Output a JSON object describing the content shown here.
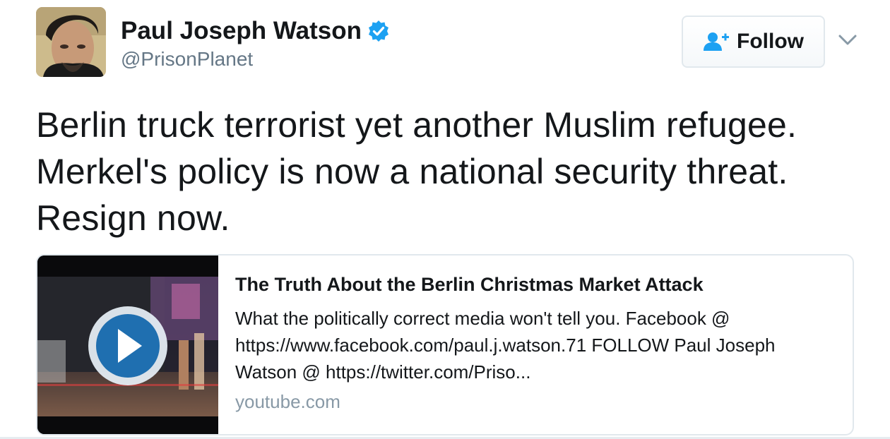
{
  "author": {
    "display_name": "Paul Joseph Watson",
    "handle": "@PrisonPlanet",
    "verified": true,
    "avatar_icon": "profile-photo"
  },
  "follow_button": {
    "label": "Follow",
    "icon": "user-add-icon"
  },
  "more_menu": {
    "icon": "chevron-down-icon"
  },
  "tweet": {
    "lines": [
      "Berlin truck terrorist yet another Muslim refugee.",
      "Merkel's policy is now a national security threat.",
      "Resign now."
    ]
  },
  "card": {
    "title": "The Truth About the Berlin Christmas Market Attack",
    "description": "What the politically correct media won't tell you. Facebook @ https://www.facebook.com/paul.j.watson.71 FOLLOW Paul Joseph Watson @ https://twitter.com/Priso...",
    "domain": "youtube.com",
    "thumbnail_icon": "play-icon"
  },
  "colors": {
    "verified_blue": "#1da1f2",
    "follow_icon_blue": "#1da1f2",
    "handle_gray": "#657786",
    "domain_gray": "#8899a6",
    "border": "#e1e8ed"
  }
}
